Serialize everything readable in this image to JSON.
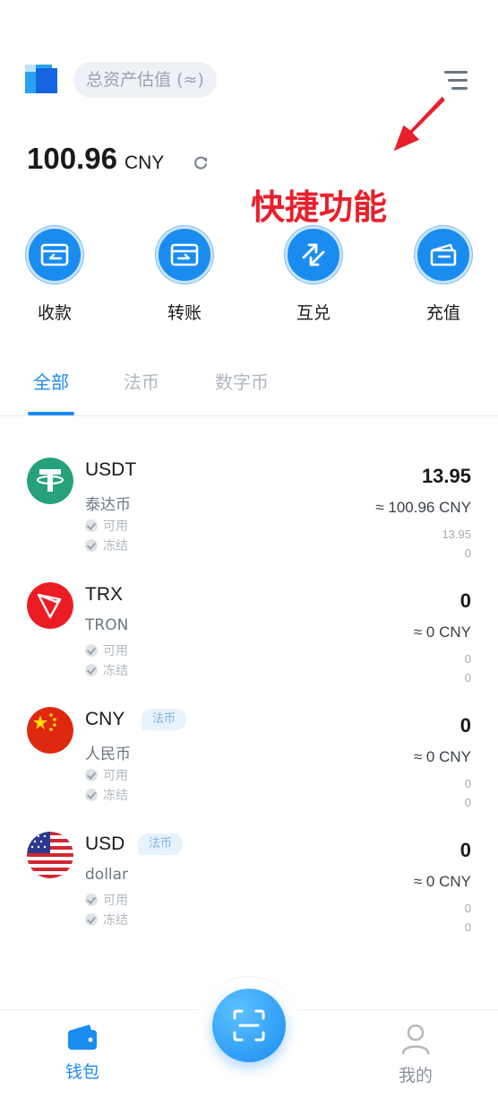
{
  "header": {
    "estimate_label": "总资产估值 (≈)",
    "balance_amount": "100.96",
    "balance_currency": "CNY"
  },
  "annotation": "快捷功能",
  "actions": [
    {
      "label": "收款",
      "icon": "receive-icon"
    },
    {
      "label": "转账",
      "icon": "transfer-icon"
    },
    {
      "label": "互兑",
      "icon": "exchange-icon"
    },
    {
      "label": "充值",
      "icon": "recharge-icon"
    }
  ],
  "tabs": [
    {
      "label": "全部",
      "active": true
    },
    {
      "label": "法币",
      "active": false
    },
    {
      "label": "数字币",
      "active": false
    }
  ],
  "assets": [
    {
      "symbol": "USDT",
      "name": "泰达币",
      "badge": "",
      "amount": "13.95",
      "value": "≈ 100.96 CNY",
      "available": "13.95",
      "frozen": "0",
      "available_label": "可用",
      "frozen_label": "冻结"
    },
    {
      "symbol": "TRX",
      "name": "TRON",
      "badge": "",
      "amount": "0",
      "value": "≈ 0 CNY",
      "available": "0",
      "frozen": "0",
      "available_label": "可用",
      "frozen_label": "冻结"
    },
    {
      "symbol": "CNY",
      "name": "人民币",
      "badge": "法币",
      "amount": "0",
      "value": "≈ 0 CNY",
      "available": "0",
      "frozen": "0",
      "available_label": "可用",
      "frozen_label": "冻结"
    },
    {
      "symbol": "USD",
      "name": "dollar",
      "badge": "法币",
      "amount": "0",
      "value": "≈ 0 CNY",
      "available": "0",
      "frozen": "0",
      "available_label": "可用",
      "frozen_label": "冻结"
    }
  ],
  "bottom_nav": {
    "wallet_label": "钱包",
    "scan_icon": "scan-icon",
    "profile_label": "我的"
  },
  "colors": {
    "accent": "#1a8cf0",
    "annotation": "#e8202c",
    "usdt": "#26a17b",
    "trx": "#eb1c24",
    "cny": "#de2910"
  }
}
